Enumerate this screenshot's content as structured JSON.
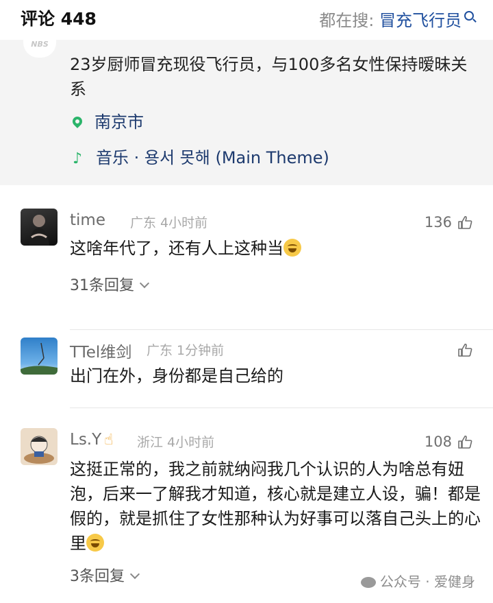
{
  "header": {
    "title": "评论 448",
    "search_prefix": "都在搜:",
    "search_keyword": "冒充飞行员"
  },
  "video": {
    "logo_text": "NBS",
    "title": "23岁厨师冒充现役飞行员，与100多名女性保持暧昧关系",
    "location": "南京市",
    "music": "音乐 · 용서 못해 (Main Theme)"
  },
  "comments": [
    {
      "username": "time",
      "location_time": "广东 4小时前",
      "likes": "136",
      "text": "这啥年代了，还有人上这种当",
      "replies": "31条回复"
    },
    {
      "username": "TTel维剑",
      "location_time": "广东 1分钟前",
      "likes": "",
      "text": "出门在外，身份都是自己给的",
      "replies": ""
    },
    {
      "username": "Ls.Y",
      "location_time": "浙江 4小时前",
      "likes": "108",
      "text": "这挺正常的，我之前就纳闷我几个认识的人为啥总有妞泡，后来一了解我才知道，核心就是建立人设，骗！都是假的，就是抓住了女性那种认为好事可以落自己头上的心里",
      "replies": "3条回复"
    }
  ],
  "watermark": "公众号 · 爱健身"
}
